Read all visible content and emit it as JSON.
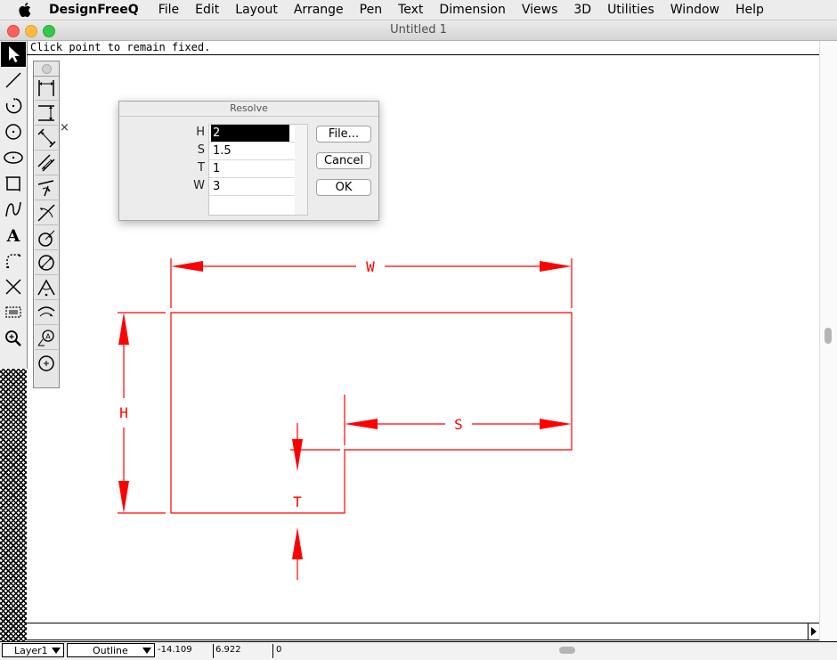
{
  "menubar": {
    "app_name": "DesignFreeQ",
    "items": [
      "File",
      "Edit",
      "Layout",
      "Arrange",
      "Pen",
      "Text",
      "Dimension",
      "Views",
      "3D",
      "Utilities",
      "Window",
      "Help"
    ]
  },
  "window": {
    "title": "Untitled 1",
    "traffic_colors": [
      "#fc605b",
      "#fdbc40",
      "#34c84a"
    ]
  },
  "prompt": {
    "text": "Click point to remain fixed."
  },
  "tools": [
    "pointer-tool",
    "line-tool",
    "arc-tool",
    "circle-tool",
    "ellipse-tool",
    "rectangle-tool",
    "curve-tool",
    "text-tool",
    "fillet-tool",
    "trim-tool",
    "group-tool",
    "zoom-tool"
  ],
  "dimension_palette": {
    "tools": [
      "horizontal-dimension",
      "vertical-dimension",
      "aligned-dimension",
      "perpendicular-dimension",
      "angle-dimension",
      "arc-dimension",
      "radius-dimension",
      "diameter-dimension",
      "angular-dimension",
      "arc-length-dimension",
      "datum-dimension",
      "center-mark"
    ],
    "close_label": "×"
  },
  "resolve": {
    "title": "Resolve",
    "variables": [
      {
        "name": "H",
        "value": "2"
      },
      {
        "name": "S",
        "value": "1.5"
      },
      {
        "name": "T",
        "value": "1"
      },
      {
        "name": "W",
        "value": "3"
      }
    ],
    "buttons": {
      "file": "File...",
      "cancel": "Cancel",
      "ok": "OK"
    }
  },
  "drawing": {
    "color": "#ff0000",
    "labels": {
      "w": "W",
      "h": "H",
      "s": "S",
      "t": "T"
    }
  },
  "status": {
    "layer": "Layer1",
    "mode": "Outline",
    "x": "-14.109",
    "y": "6.922",
    "z": "0"
  }
}
